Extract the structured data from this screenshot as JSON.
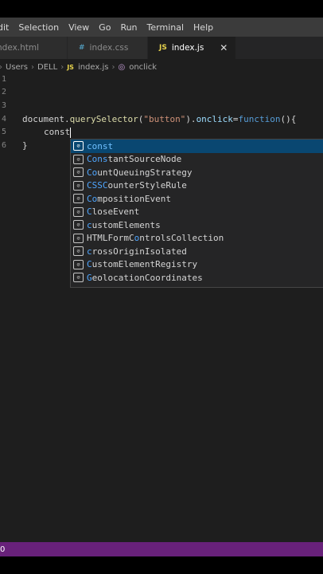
{
  "menu": [
    "dit",
    "Selection",
    "View",
    "Go",
    "Run",
    "Terminal",
    "Help"
  ],
  "tabs": [
    {
      "icon": "",
      "label": "ndex.html",
      "active": false
    },
    {
      "icon": "#",
      "label": "index.css",
      "active": false
    },
    {
      "icon": "JS",
      "label": "index.js",
      "active": true,
      "close": "✕"
    }
  ],
  "breadcrumb": {
    "parts": [
      "Users",
      "DELL"
    ],
    "file_icon": "JS",
    "file": "index.js",
    "symbol": "onclick",
    "separator": "›"
  },
  "editor": {
    "line_numbers": [
      "1",
      "2",
      "3",
      "4",
      "5",
      "6"
    ],
    "line4": {
      "a": "document.",
      "b": "querySelector",
      "c": "(",
      "d": "\"button\"",
      "e": ").",
      "f": "onclick",
      "g": "=",
      "h": "function",
      "i": "(){"
    },
    "line5": "const",
    "line6": "}"
  },
  "suggestions": [
    {
      "pre": "",
      "hl": "const",
      "post": "",
      "selected": true
    },
    {
      "pre": "",
      "hl": "Cons",
      "post": "tantSourceNode",
      "selected": false
    },
    {
      "pre": "",
      "hl": "Co",
      "post": "untQueuingStrategy",
      "selected": false
    },
    {
      "pre": "",
      "hl": "CSSC",
      "post": "ounterStyleRule",
      "selected": false
    },
    {
      "pre": "",
      "hl": "Co",
      "post": "mpositionEvent",
      "selected": false
    },
    {
      "pre": "",
      "hl": "C",
      "post": "loseEvent",
      "selected": false
    },
    {
      "pre": "",
      "hl": "c",
      "post": "ustomElements",
      "selected": false
    },
    {
      "pre": "HTMLFormC",
      "hl": "o",
      "post": "ntrolsCollection",
      "selected": false
    },
    {
      "pre": "",
      "hl": "c",
      "post": "rossOriginIsolated",
      "selected": false
    },
    {
      "pre": "",
      "hl": "C",
      "post": "ustomElementRegistry",
      "selected": false
    },
    {
      "pre": "",
      "hl": "G",
      "post": "eolocationCoordinates",
      "selected": false
    }
  ],
  "suggestion_icon": "[⊘]",
  "status": {
    "left": "0"
  },
  "colors": {
    "statusbar": "#68217a",
    "selection": "#094771",
    "keyword": "#569cd6"
  }
}
